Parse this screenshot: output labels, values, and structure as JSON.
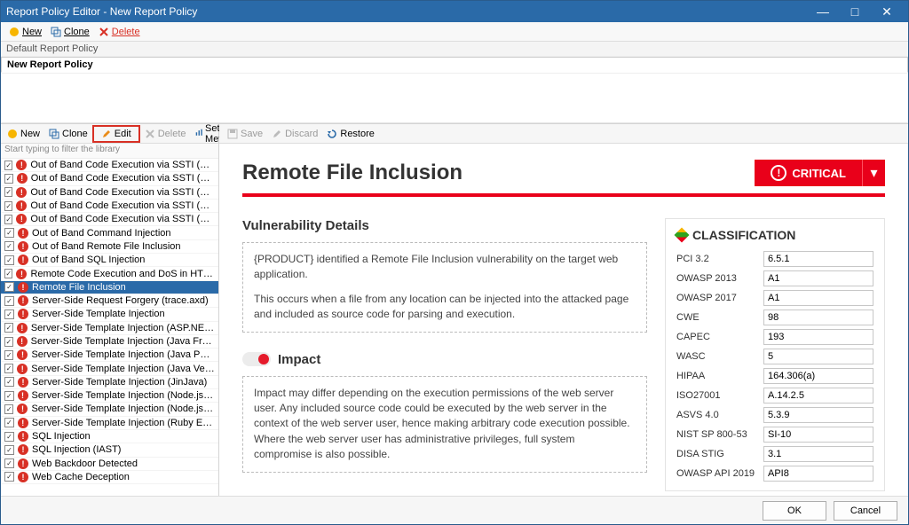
{
  "window": {
    "title": "Report Policy Editor - New Report Policy"
  },
  "top_toolbar": {
    "new": "New",
    "clone": "Clone",
    "delete": "Delete"
  },
  "policies": {
    "crumb_default": "Default Report Policy",
    "crumb_current": "New Report Policy"
  },
  "left_toolbar": {
    "new": "New",
    "clone": "Clone",
    "edit": "Edit",
    "delete": "Delete",
    "set_metrics": "Set Metrics"
  },
  "filter_hint": "Start typing to filter the library",
  "vulns": [
    "Out of Band Code Execution via SSTI (PHP Smarty)",
    "Out of Band Code Execution via SSTI (PHP Twig)",
    "Out of Band Code Execution via SSTI (Python Jinja)",
    "Out of Band Code Execution via SSTI (Python Ma...",
    "Out of Band Code Execution via SSTI (Python Tor...",
    "Out of Band Command Injection",
    "Out of Band Remote File Inclusion",
    "Out of Band SQL Injection",
    "Remote Code Execution and DoS in HTTP.sys (IIS)",
    "Remote File Inclusion",
    "Server-Side Request Forgery (trace.axd)",
    "Server-Side Template Injection",
    "Server-Side Template Injection (ASP.NET Razor)",
    "Server-Side Template Injection (Java FreeMarker)",
    "Server-Side Template Injection (Java Pebble)",
    "Server-Side Template Injection (Java Velocity)",
    "Server-Side Template Injection (JinJava)",
    "Server-Side Template Injection (Node.js Dot)",
    "Server-Side Template Injection (Node.js EJS)",
    "Server-Side Template Injection (Ruby ERB)",
    "SQL Injection",
    "SQL Injection (IAST)",
    "Web Backdoor Detected",
    "Web Cache Deception"
  ],
  "selected_index": 9,
  "right_toolbar": {
    "save": "Save",
    "discard": "Discard",
    "restore": "Restore"
  },
  "detail": {
    "title": "Remote File Inclusion",
    "severity": "CRITICAL",
    "vuln_details_h": "Vulnerability Details",
    "vuln_details_p1": "{PRODUCT} identified a Remote File Inclusion vulnerability on the target web application.",
    "vuln_details_p2": "This occurs when a file from any location can be injected into the attacked page and included as source code for parsing and execution.",
    "impact_h": "Impact",
    "impact_body": "Impact may differ depending on the execution permissions of the web server user. Any included source code could be executed by the web server in the context of the web server user, hence making arbitrary code execution possible. Where the web server user has administrative privileges, full system compromise is also possible."
  },
  "classification": {
    "heading": "CLASSIFICATION",
    "rows": [
      {
        "k": "PCI 3.2",
        "v": "6.5.1"
      },
      {
        "k": "OWASP 2013",
        "v": "A1"
      },
      {
        "k": "OWASP 2017",
        "v": "A1"
      },
      {
        "k": "CWE",
        "v": "98"
      },
      {
        "k": "CAPEC",
        "v": "193"
      },
      {
        "k": "WASC",
        "v": "5"
      },
      {
        "k": "HIPAA",
        "v": "164.306(a)"
      },
      {
        "k": "ISO27001",
        "v": "A.14.2.5"
      },
      {
        "k": "ASVS 4.0",
        "v": "5.3.9"
      },
      {
        "k": "NIST SP 800-53",
        "v": "SI-10"
      },
      {
        "k": "DISA STIG",
        "v": "3.1"
      },
      {
        "k": "OWASP API 2019",
        "v": "API8"
      }
    ]
  },
  "footer": {
    "ok": "OK",
    "cancel": "Cancel"
  }
}
